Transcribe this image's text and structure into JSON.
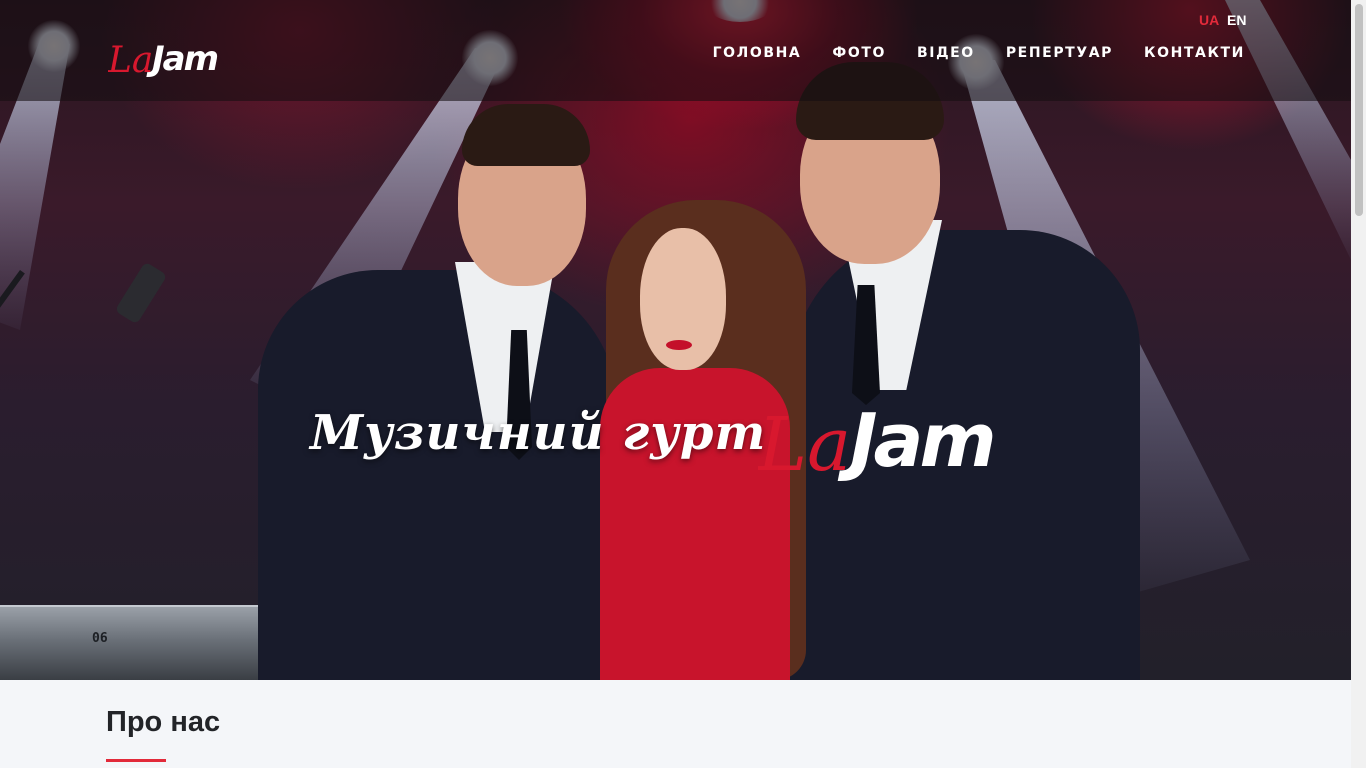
{
  "header": {
    "logo": {
      "script": "La",
      "word": "Jam"
    },
    "languages": [
      {
        "code": "UA",
        "active": true
      },
      {
        "code": "EN",
        "active": false
      }
    ],
    "nav": [
      {
        "label": "ГОЛОВНА"
      },
      {
        "label": "ФОТО"
      },
      {
        "label": "ВІДЕО"
      },
      {
        "label": "РЕПЕРТУАР"
      },
      {
        "label": "КОНТАКТИ"
      }
    ]
  },
  "hero": {
    "title": "Музичний гурт",
    "logo": {
      "script": "La",
      "word": "Jam"
    },
    "keyboard_label": "06"
  },
  "about": {
    "title": "Про нас"
  },
  "colors": {
    "accent": "#e22a3a",
    "nav_text": "#ffffff",
    "section_bg": "#f4f6f9"
  }
}
